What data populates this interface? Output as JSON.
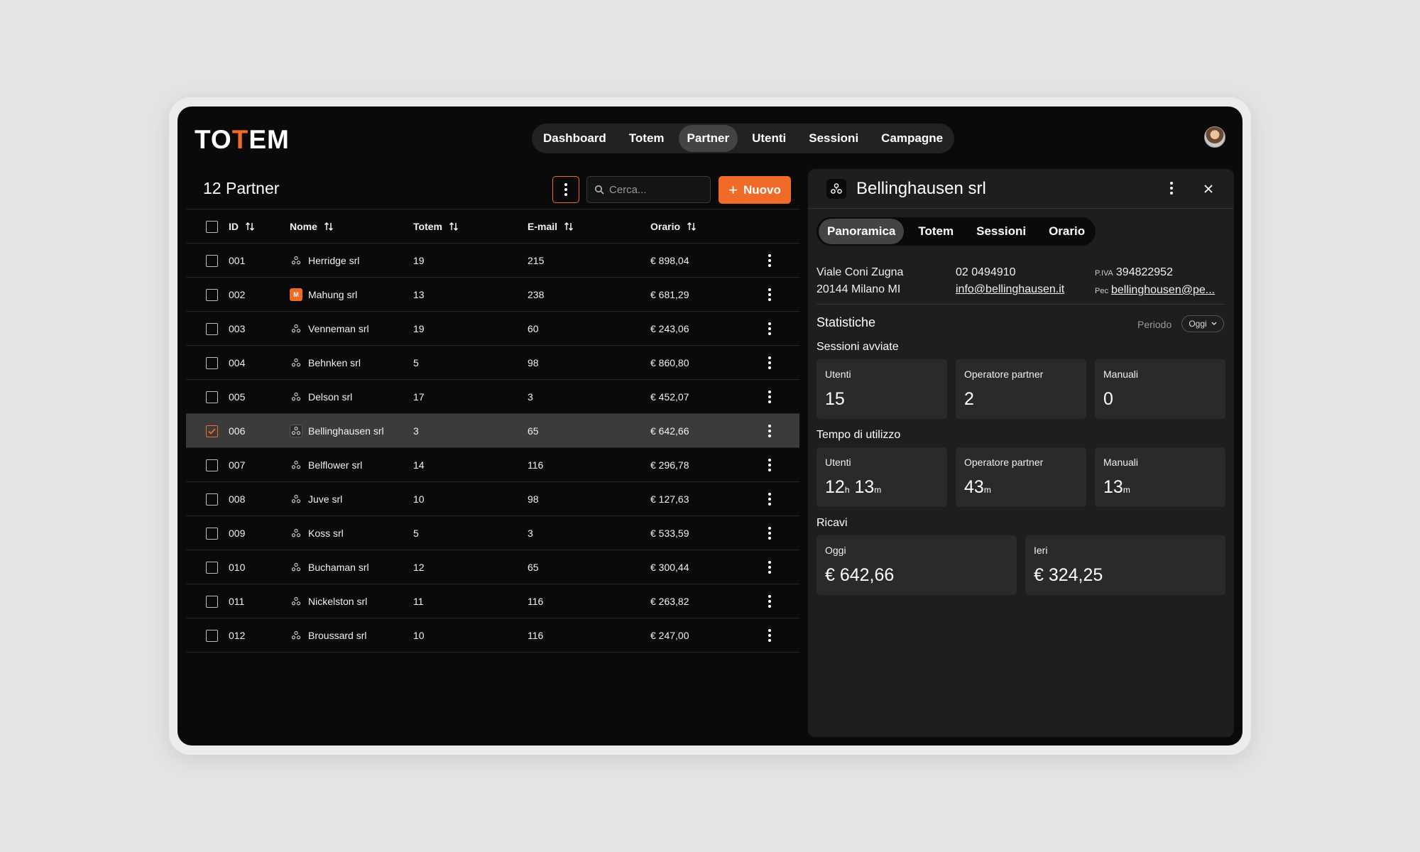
{
  "app": {
    "logo_left": "TO",
    "logo_accent": "T",
    "logo_right": "EM"
  },
  "nav": {
    "items": [
      "Dashboard",
      "Totem",
      "Partner",
      "Utenti",
      "Sessioni",
      "Campagne"
    ],
    "active": "Partner"
  },
  "list": {
    "title": "12 Partner",
    "search_placeholder": "Cerca...",
    "new_label": "Nuovo",
    "columns": {
      "id": "ID",
      "name": "Nome",
      "totem": "Totem",
      "email": "E-mail",
      "orario": "Orario"
    },
    "rows": [
      {
        "id": "001",
        "name": "Herridge srl",
        "totem": "19",
        "email": "215",
        "orario": "€ 898,04",
        "icon": "partner-icon",
        "selected": false
      },
      {
        "id": "002",
        "name": "Mahung srl",
        "totem": "13",
        "email": "238",
        "orario": "€ 681,29",
        "icon": "brand-m-icon",
        "icon_text": "M",
        "selected": false
      },
      {
        "id": "003",
        "name": "Venneman srl",
        "totem": "19",
        "email": "60",
        "orario": "€ 243,06",
        "icon": "partner-icon",
        "selected": false
      },
      {
        "id": "004",
        "name": "Behnken srl",
        "totem": "5",
        "email": "98",
        "orario": "€ 860,80",
        "icon": "partner-icon",
        "selected": false
      },
      {
        "id": "005",
        "name": "Delson srl",
        "totem": "17",
        "email": "3",
        "orario": "€ 452,07",
        "icon": "partner-icon",
        "selected": false
      },
      {
        "id": "006",
        "name": "Bellinghausen srl",
        "totem": "3",
        "email": "65",
        "orario": "€ 642,66",
        "icon": "partner-icon",
        "selected": true
      },
      {
        "id": "007",
        "name": "Belflower srl",
        "totem": "14",
        "email": "116",
        "orario": "€ 296,78",
        "icon": "partner-icon",
        "selected": false
      },
      {
        "id": "008",
        "name": "Juve srl",
        "totem": "10",
        "email": "98",
        "orario": "€ 127,63",
        "icon": "partner-icon",
        "selected": false
      },
      {
        "id": "009",
        "name": "Koss srl",
        "totem": "5",
        "email": "3",
        "orario": "€ 533,59",
        "icon": "partner-icon",
        "selected": false
      },
      {
        "id": "010",
        "name": "Buchaman srl",
        "totem": "12",
        "email": "65",
        "orario": "€ 300,44",
        "icon": "partner-icon",
        "selected": false
      },
      {
        "id": "011",
        "name": "Nickelston srl",
        "totem": "11",
        "email": "116",
        "orario": "€ 263,82",
        "icon": "partner-icon",
        "selected": false
      },
      {
        "id": "012",
        "name": "Broussard srl",
        "totem": "10",
        "email": "116",
        "orario": "€ 247,00",
        "icon": "partner-icon",
        "selected": false
      }
    ]
  },
  "detail": {
    "title": "Bellinghausen srl",
    "tabs": [
      "Panoramica",
      "Totem",
      "Sessioni",
      "Orario"
    ],
    "active_tab": "Panoramica",
    "address_line1": "Viale Coni Zugna",
    "address_line2": "20144 Milano MI",
    "phone": "02 0494910",
    "email": "info@bellinghausen.it",
    "piva_label": "P.IVA",
    "piva": "394822952",
    "pec_label": "Pec",
    "pec": "bellinghousen@pe...",
    "stats_title": "Statistiche",
    "periodo_label": "Periodo",
    "periodo_value": "Oggi",
    "sessions_title": "Sessioni avviate",
    "sessions": [
      {
        "label": "Utenti",
        "value": "15"
      },
      {
        "label": "Operatore partner",
        "value": "2"
      },
      {
        "label": "Manuali",
        "value": "0"
      }
    ],
    "usage_title": "Tempo di utilizzo",
    "usage": [
      {
        "label": "Utenti",
        "h": "12",
        "h_unit": "h",
        "m": "13",
        "m_unit": "m"
      },
      {
        "label": "Operatore partner",
        "m": "43",
        "m_unit": "m"
      },
      {
        "label": "Manuali",
        "m": "13",
        "m_unit": "m"
      }
    ],
    "revenue_title": "Ricavi",
    "revenue": [
      {
        "label": "Oggi",
        "value": "€ 642,66"
      },
      {
        "label": "Ieri",
        "value": "€ 324,25"
      }
    ]
  },
  "colors": {
    "accent": "#f06a28",
    "background": "#0a0a0a",
    "panel": "#1e1e1e",
    "card": "#2a2a2a"
  }
}
